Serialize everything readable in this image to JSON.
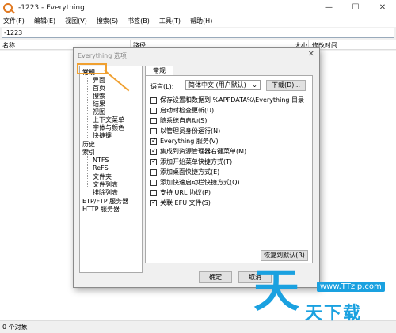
{
  "window": {
    "title": "-1223 - Everything"
  },
  "menu": [
    "文件(F)",
    "编辑(E)",
    "视图(V)",
    "搜索(S)",
    "书签(B)",
    "工具(T)",
    "帮助(H)"
  ],
  "search": {
    "value": "-1223"
  },
  "columns": {
    "name": "名称",
    "path": "路径",
    "size": "大小",
    "modified": "修改时间"
  },
  "status": {
    "text": "0 个对象"
  },
  "dialog": {
    "title": "Everything 选项",
    "tree": {
      "general": "常规",
      "ui": "界面",
      "home": "首页",
      "search": "搜索",
      "results": "结果",
      "view": "视图",
      "context_menu": "上下文菜单",
      "fonts_colors": "字体与颜色",
      "shortcuts": "快捷键",
      "history": "历史",
      "index": "索引",
      "ntfs": "NTFS",
      "refs": "ReFS",
      "folders": "文件夹",
      "file_list": "文件列表",
      "exclude": "排除列表",
      "etp": "ETP/FTP 服务器",
      "http": "HTTP 服务器"
    },
    "tab": "常规",
    "language_label": "语言(L):",
    "language_value": "简体中文 (用户默认)",
    "download_button": "下载(D)...",
    "options": [
      {
        "label": "保存设置和数据到 %APPDATA%\\Everything 目录",
        "checked": false
      },
      {
        "label": "启动时检查更新(U)",
        "checked": false
      },
      {
        "label": "随系统自启动(S)",
        "checked": false
      },
      {
        "label": "以管理员身份运行(N)",
        "checked": false
      },
      {
        "label": "Everything 服务(V)",
        "checked": true
      },
      {
        "label": "集成到资源管理器右键菜单(M)",
        "checked": true
      },
      {
        "label": "添加开始菜单快捷方式(T)",
        "checked": true
      },
      {
        "label": "添加桌面快捷方式(E)",
        "checked": false
      },
      {
        "label": "添加快速启动栏快捷方式(Q)",
        "checked": false
      },
      {
        "label": "支持 URL 协议(P)",
        "checked": false
      },
      {
        "label": "关联 EFU 文件(S)",
        "checked": true
      }
    ],
    "restore_button": "恢复到默认(R)",
    "ok_button": "确定",
    "cancel_button": "取消"
  },
  "watermark": {
    "char": "天",
    "url": "www.TTzip.com",
    "text": "天下载"
  },
  "colors": {
    "accent": "#f0a030",
    "watermark": "#1aa1e0"
  }
}
